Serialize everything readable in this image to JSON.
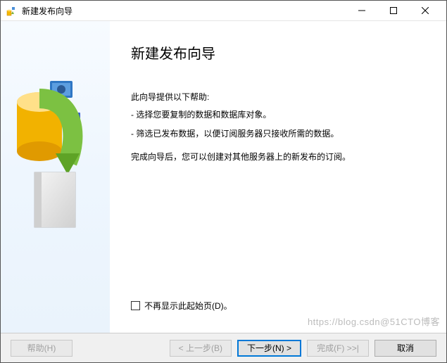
{
  "window": {
    "title": "新建发布向导"
  },
  "heading": "新建发布向导",
  "intro": "此向导提供以下帮助:",
  "bullet1": "- 选择您要复制的数据和数据库对象。",
  "bullet2": "- 筛选已发布数据，以便订阅服务器只接收所需的数据。",
  "conclusion": "完成向导后，您可以创建对其他服务器上的新发布的订阅。",
  "checkbox": {
    "label": "不再显示此起始页(D)。"
  },
  "buttons": {
    "help": "帮助(H)",
    "back": "< 上一步(B)",
    "next": "下一步(N) >",
    "finish": "完成(F) >>|",
    "cancel": "取消"
  },
  "watermark": "https://blog.csdn@51CTO博客"
}
